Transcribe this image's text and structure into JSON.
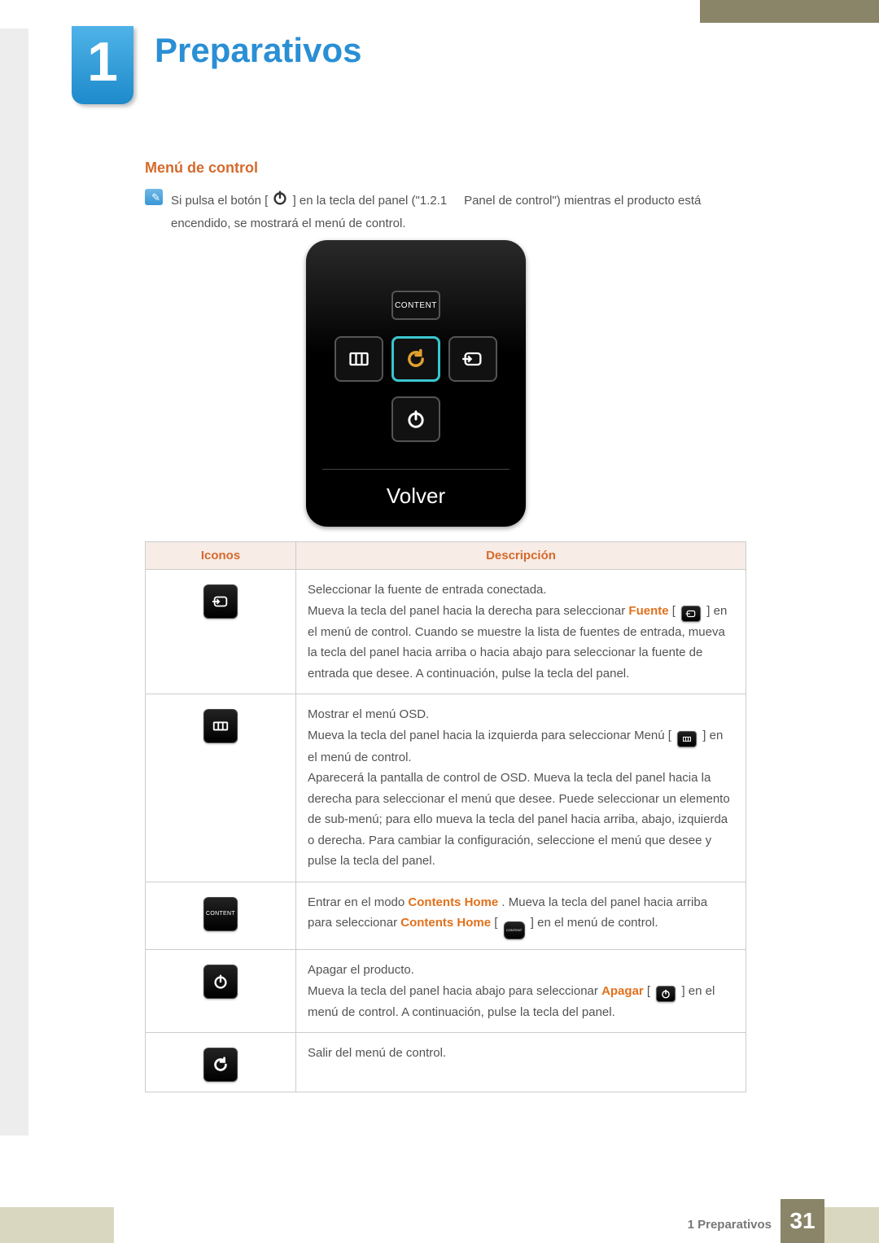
{
  "chapter": {
    "number": "1",
    "title": "Preparativos"
  },
  "section_title": "Menú de control",
  "intro": {
    "p1a": "Si pulsa el botón [",
    "p1b": "] en la tecla del panel (\"1.2.1",
    "p1c": "Panel de control\") mientras el producto está encendido, se mostrará el menú de control."
  },
  "device": {
    "content_label": "CONTENT",
    "volver": "Volver"
  },
  "table": {
    "headers": {
      "icons": "Iconos",
      "desc": "Descripción"
    },
    "rows": {
      "source": {
        "title": "Seleccionar la fuente de entrada conectada.",
        "p_a": "Mueva la tecla del panel hacia la derecha para seleccionar ",
        "kw": "Fuente",
        "p_b": " [",
        "p_c": "] en el menú de control. Cuando se muestre la lista de fuentes de entrada, mueva la tecla del panel hacia arriba o hacia abajo para seleccionar la fuente de entrada que desee. A continuación, pulse la tecla del panel."
      },
      "menu": {
        "title": "Mostrar el menú OSD.",
        "p_a": "Mueva la tecla del panel hacia la izquierda para seleccionar Menú [",
        "p_b": "] en el menú de control.",
        "p2": "Aparecerá la pantalla de control de OSD. Mueva la tecla del panel hacia la derecha para seleccionar el menú que desee. Puede seleccionar un elemento de sub-menú; para ello mueva la tecla del panel hacia arriba, abajo, izquierda o derecha. Para cambiar la configuración, seleccione el menú que desee y pulse la tecla del panel."
      },
      "content": {
        "pre": "Entrar en el modo ",
        "kw": "Contents Home",
        "mid": ". Mueva la tecla del panel hacia arriba para seleccionar ",
        "kw2": "Contents Home",
        "post_a": " [",
        "post_b": "] en el menú de control.",
        "icon_label": "CONTENT"
      },
      "power": {
        "title": "Apagar el producto.",
        "p_a": "Mueva la tecla del panel hacia abajo para seleccionar ",
        "kw": "Apagar",
        "p_b": " [",
        "p_c": "] en el menú de control. A continuación, pulse la tecla del panel."
      },
      "return": {
        "title": "Salir del menú de control."
      }
    }
  },
  "footer": {
    "text": "1 Preparativos",
    "page": "31"
  }
}
